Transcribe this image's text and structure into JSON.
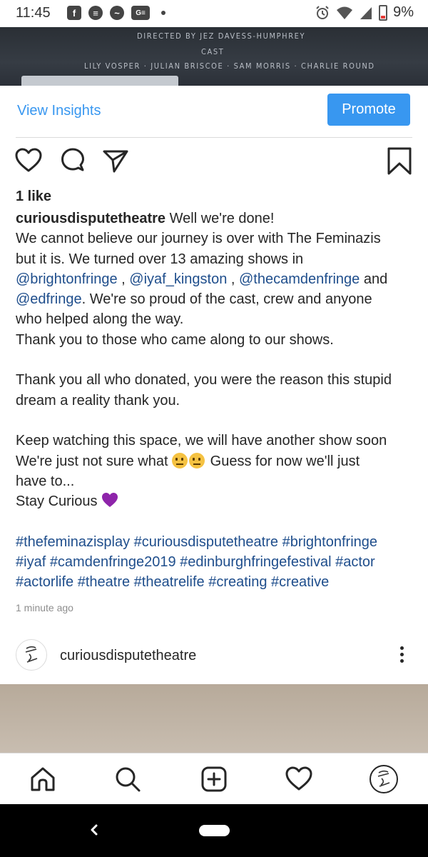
{
  "status_bar": {
    "time": "11:45",
    "left_icons": [
      "facebook-icon",
      "app-icon",
      "messenger-icon",
      "news-icon"
    ],
    "battery_percent": "9%"
  },
  "poster": {
    "line1": "DIRECTED BY JEZ DAVESS-HUMPHREY",
    "line2": "CAST",
    "line3": "LILY VOSPER · JULIAN BRISCOE · SAM MORRIS · CHARLIE ROUND"
  },
  "insights": {
    "view_label": "View Insights",
    "promote_label": "Promote"
  },
  "post": {
    "likes": "1 like",
    "username": "curiousdisputetheatre",
    "caption_lines": {
      "l1": "Well we're done!",
      "l2": "We cannot believe our journey is over with The Feminazis",
      "l3a": "but it is. We turned over 13 amazing shows in",
      "m1": "@brightonfringe",
      "sep1": " , ",
      "m2": "@iyaf_kingston",
      "sep2": " , ",
      "m3": "@thecamdenfringe",
      "and": " and",
      "m4": "@edfringe",
      "l4b": ". We're so proud of the cast, crew and anyone",
      "l5": "who helped along the way.",
      "l6": "Thank you to those who came along to our shows.",
      "l7": "Thank you all who donated, you were the reason this stupid",
      "l8": "dream a reality thank you.",
      "l9": "Keep watching this space, we will have another show soon",
      "l10a": "We're just not sure what",
      "l10b": " Guess for now we'll just",
      "l11": "have to...",
      "l12": "Stay Curious"
    },
    "hashtags": {
      "h1": "#thefeminazisplay",
      "h2": "#curiousdisputetheatre",
      "h3": "#brightonfringe",
      "h4": "#iyaf",
      "h5": "#camdenfringe2019",
      "h6": "#edinburghfringefestival",
      "h7": "#actor",
      "h8": "#actorlife",
      "h9": "#theatre",
      "h10": "#theatrelife",
      "h11": "#creating",
      "h12": "#creative"
    },
    "time_ago": "1 minute ago"
  },
  "next_post": {
    "username": "curiousdisputetheatre"
  },
  "colors": {
    "accent": "#3897f0",
    "link": "#1f4e8c",
    "heart_emoji": "#8e24aa"
  }
}
